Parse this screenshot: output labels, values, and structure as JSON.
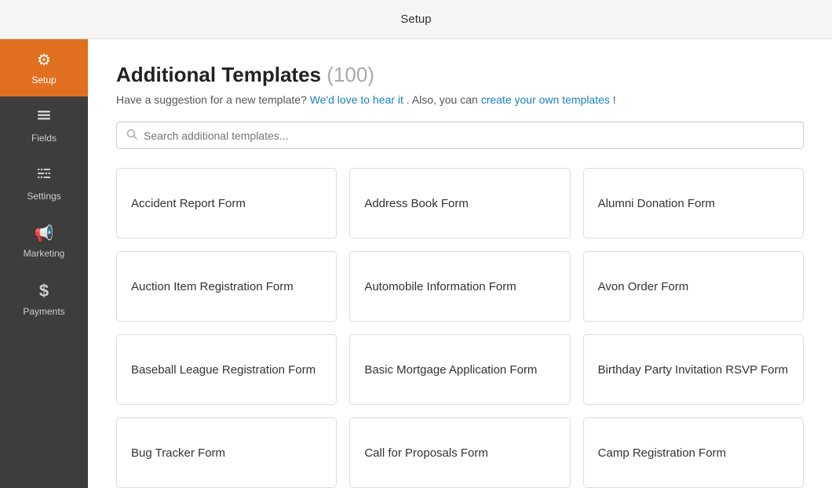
{
  "topbar": {
    "title": "Setup"
  },
  "sidebar": {
    "items": [
      {
        "id": "setup",
        "label": "Setup",
        "icon": "⚙",
        "active": true
      },
      {
        "id": "fields",
        "label": "Fields",
        "icon": "☰",
        "active": false
      },
      {
        "id": "settings",
        "label": "Settings",
        "icon": "⊟",
        "active": false
      },
      {
        "id": "marketing",
        "label": "Marketing",
        "icon": "📢",
        "active": false
      },
      {
        "id": "payments",
        "label": "Payments",
        "icon": "$",
        "active": false
      }
    ]
  },
  "content": {
    "title": "Additional Templates",
    "count": "(100)",
    "subtitle_static": "Have a suggestion for a new template?",
    "link1_text": "We'd love to hear it",
    "link1_href": "#",
    "subtitle_mid": ". Also, you can",
    "link2_text": "create your own templates",
    "link2_href": "#",
    "subtitle_end": "!",
    "search_placeholder": "Search additional templates...",
    "templates": [
      {
        "id": 1,
        "name": "Accident Report Form"
      },
      {
        "id": 2,
        "name": "Address Book Form"
      },
      {
        "id": 3,
        "name": "Alumni Donation Form"
      },
      {
        "id": 4,
        "name": "Auction Item Registration Form"
      },
      {
        "id": 5,
        "name": "Automobile Information Form"
      },
      {
        "id": 6,
        "name": "Avon Order Form"
      },
      {
        "id": 7,
        "name": "Baseball League Registration Form"
      },
      {
        "id": 8,
        "name": "Basic Mortgage Application Form"
      },
      {
        "id": 9,
        "name": "Birthday Party Invitation RSVP Form"
      },
      {
        "id": 10,
        "name": "Bug Tracker Form"
      },
      {
        "id": 11,
        "name": "Call for Proposals Form"
      },
      {
        "id": 12,
        "name": "Camp Registration Form"
      }
    ]
  }
}
